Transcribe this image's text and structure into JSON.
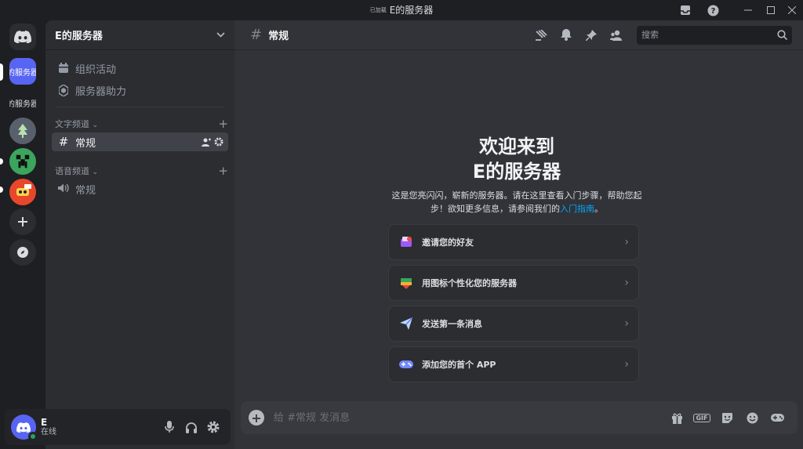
{
  "window": {
    "badge_text": "已加载",
    "title": "E的服务器"
  },
  "rail": {
    "selected_server_label": "的服务器",
    "second_server_label": "的服务器"
  },
  "sidebar": {
    "guild_name": "E的服务器",
    "items": [
      {
        "label": "组织活动",
        "icon": "calendar-icon"
      },
      {
        "label": "服务器助力",
        "icon": "boost-icon"
      }
    ],
    "text_category": "文字频道",
    "text_channels": [
      {
        "label": "常规"
      }
    ],
    "voice_category": "语音频道",
    "voice_channels": [
      {
        "label": "常规"
      }
    ]
  },
  "user": {
    "name": "E",
    "status": "在线"
  },
  "chat": {
    "channel_name": "常规",
    "search_placeholder": "搜索",
    "welcome_title_line1": "欢迎来到",
    "welcome_title_line2": "E的服务器",
    "welcome_desc": "这是您亮闪闪，崭新的服务器。请在这里查看入门步骤，帮助您起步！欲知更多信息，请参阅我们的",
    "welcome_link": "入门指南",
    "welcome_period": "。",
    "actions": [
      {
        "label": "邀请您的好友",
        "icon": "invite-icon"
      },
      {
        "label": "用图标个性化您的服务器",
        "icon": "personalize-icon"
      },
      {
        "label": "发送第一条消息",
        "icon": "send-icon"
      },
      {
        "label": "添加您的首个 APP",
        "icon": "app-icon"
      }
    ],
    "composer_placeholder": "给 #常规 发消息",
    "gif_label": "GIF"
  },
  "colors": {
    "accent": "#5865f2",
    "online": "#23a55a",
    "link": "#00a8fc"
  }
}
